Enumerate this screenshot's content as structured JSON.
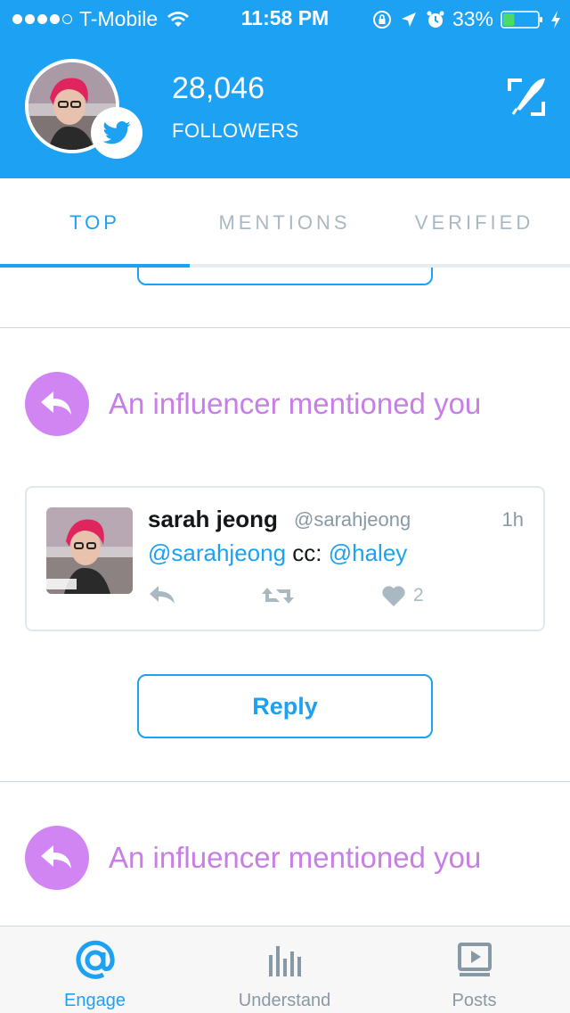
{
  "status_bar": {
    "carrier": "T-Mobile",
    "time": "11:58 PM",
    "battery": "33%",
    "battery_level": 0.33,
    "signal_bars_filled": 4,
    "signal_bars_total": 5
  },
  "header": {
    "followers_count": "28,046",
    "followers_label": "FOLLOWERS",
    "background_color": "#1da1f2"
  },
  "tabs": [
    {
      "label": "TOP",
      "active": true
    },
    {
      "label": "MENTIONS",
      "active": false
    },
    {
      "label": "VERIFIED",
      "active": false
    }
  ],
  "feed": {
    "mention_1": {
      "title": "An influencer mentioned you",
      "tweet": {
        "name": "sarah jeong",
        "handle": "@sarahjeong",
        "time": "1h",
        "text_mention_1": "@sarahjeong",
        "text_middle": " cc: ",
        "text_mention_2": "@haley",
        "like_count": "2"
      },
      "reply_label": "Reply"
    },
    "mention_2": {
      "title": "An influencer mentioned you"
    }
  },
  "bottom_nav": [
    {
      "label": "Engage",
      "icon": "at-icon",
      "active": true
    },
    {
      "label": "Understand",
      "icon": "bars-icon",
      "active": false
    },
    {
      "label": "Posts",
      "icon": "video-icon",
      "active": false
    }
  ],
  "colors": {
    "accent": "#1da1f2",
    "mention_purple": "#c77fe6",
    "muted": "#8899a6"
  }
}
